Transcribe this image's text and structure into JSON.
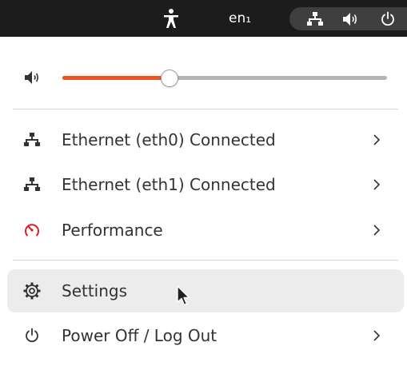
{
  "topbar": {
    "language": "en₁",
    "icons": [
      "accessibility-icon",
      "network-icon",
      "volume-icon",
      "power-icon"
    ]
  },
  "volume": {
    "level": 0.33,
    "icon": "volume-icon"
  },
  "menu": {
    "items": [
      {
        "label": "Ethernet (eth0) Connected",
        "icon": "network-icon",
        "has_submenu": true
      },
      {
        "label": "Ethernet (eth1) Connected",
        "icon": "network-icon",
        "has_submenu": true
      },
      {
        "label": "Performance",
        "icon": "performance-icon",
        "icon_color": "#e01b24",
        "has_submenu": true
      },
      {
        "label": "Settings",
        "icon": "gear-icon",
        "has_submenu": false,
        "hovered": true
      },
      {
        "label": "Power Off / Log Out",
        "icon": "power-icon",
        "has_submenu": true
      }
    ]
  },
  "colors": {
    "topbar_bg": "#1c1c1c",
    "accent": "#e95420",
    "hover_bg": "#ececec",
    "text": "#333333"
  }
}
